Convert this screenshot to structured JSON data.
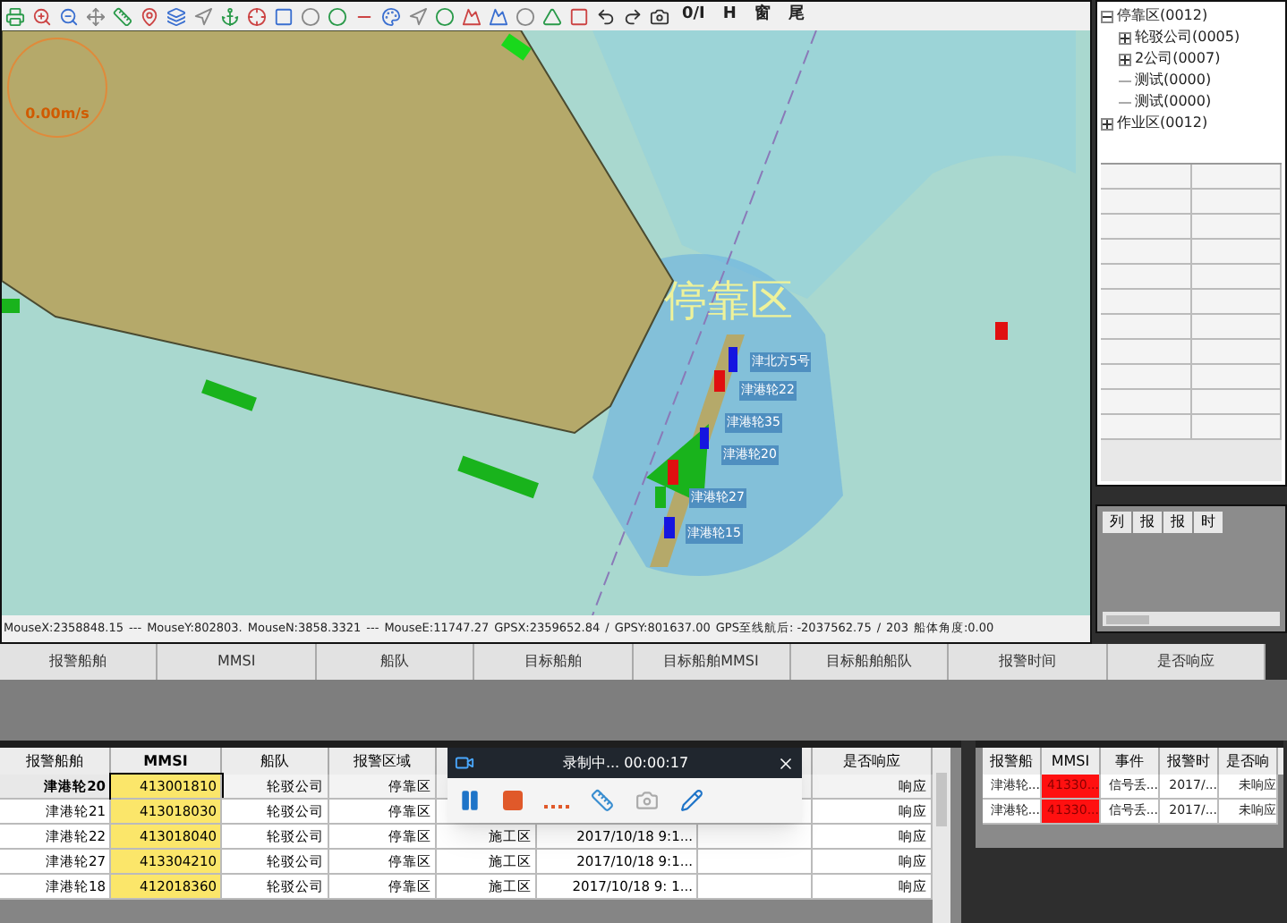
{
  "toolbar": {
    "labels": [
      "0/I",
      "H",
      "窗",
      "尾"
    ]
  },
  "map": {
    "speed": "0.00m/s",
    "zone_label": "停靠区",
    "ships": [
      "津北方5号",
      "津港轮22",
      "津港轮35",
      "津港轮20",
      "津港轮27",
      "津港轮15"
    ]
  },
  "status_bar": [
    "MouseX:2358848.15",
    "---",
    "MouseY:802803.",
    "MouseN:3858.3321",
    "---",
    "MouseE:11747.27",
    "GPSX:2359652.84",
    "/",
    "GPSY:801637.00",
    "GPS至线航后: -2037562.75",
    "/",
    "203",
    "船体角度:0.00"
  ],
  "tree": [
    {
      "label": "停靠区(0012)",
      "expanded": true,
      "children": [
        {
          "label": "轮驳公司(0005)",
          "expanded": false
        },
        {
          "label": "2公司(0007)",
          "expanded": false
        },
        {
          "label": "测试(0000)"
        },
        {
          "label": "测试(0000)"
        }
      ]
    },
    {
      "label": "作业区(0012)",
      "expanded": false
    }
  ],
  "side_grid": {
    "columns": [
      "列",
      "报",
      "报",
      "时"
    ]
  },
  "alarm_header": {
    "columns": [
      "报警船舶",
      "MMSI",
      "船队",
      "目标船舶",
      "目标船舶MMSI",
      "目标船舶船队",
      "报警时间",
      "是否响应"
    ]
  },
  "zone_table": {
    "columns": [
      "报警船舶",
      "MMSI",
      "船队",
      "报警区域",
      "",
      "",
      "",
      "是否响应"
    ],
    "rows": [
      {
        "selected": true,
        "cells": [
          "津港轮20",
          "413001810",
          "轮驳公司",
          "停靠区",
          "",
          "",
          "",
          "响应"
        ]
      },
      {
        "selected": false,
        "cells": [
          "津港轮21",
          "413018030",
          "轮驳公司",
          "停靠区",
          "",
          "",
          "",
          "响应"
        ]
      },
      {
        "selected": false,
        "cells": [
          "津港轮22",
          "413018040",
          "轮驳公司",
          "停靠区",
          "施工区",
          "2017/10/18 9:1...",
          "",
          "响应"
        ]
      },
      {
        "selected": false,
        "cells": [
          "津港轮27",
          "413304210",
          "轮驳公司",
          "停靠区",
          "施工区",
          "2017/10/18 9:1...",
          "",
          "响应"
        ]
      },
      {
        "selected": false,
        "cells": [
          "津港轮18",
          "412018360",
          "轮驳公司",
          "停靠区",
          "施工区",
          "2017/10/18 9: 1...",
          "",
          "响应"
        ]
      }
    ]
  },
  "recorder": {
    "title": "录制中... 00:00:17"
  },
  "event_table": {
    "columns": [
      "报警船",
      "MMSI",
      "事件",
      "报警时",
      "是否响"
    ],
    "rows": [
      {
        "alert": true,
        "cells": [
          "津港轮...",
          "41330...",
          "信号丢...",
          "2017/...",
          "未响应"
        ]
      },
      {
        "alert": true,
        "cells": [
          "津港轮...",
          "41330...",
          "信号丢...",
          "2017/...",
          "未响应"
        ]
      }
    ]
  }
}
